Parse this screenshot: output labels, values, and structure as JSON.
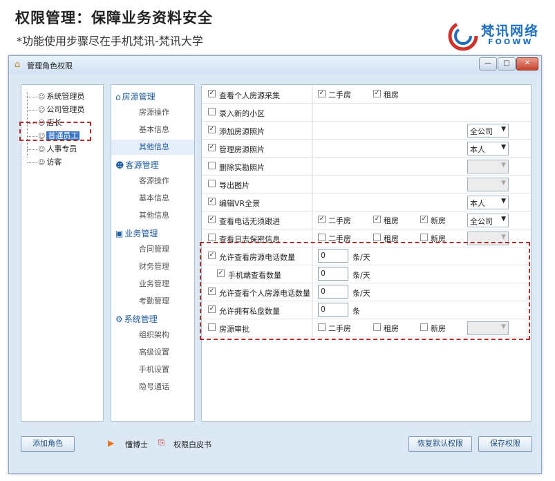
{
  "banner": {
    "title": "权限管理：保障业务资料安全",
    "subtitle": "*功能使用步骤尽在手机梵讯-梵讯大学",
    "logo_cn": "梵讯网络",
    "logo_en": "FOOWW"
  },
  "window": {
    "title": "管理角色权限",
    "controls": {
      "minimize": "—",
      "maximize": "□",
      "close": "✕"
    }
  },
  "roles": [
    "系统管理员",
    "公司管理员",
    "店长",
    "普通员工",
    "人事专员",
    "访客"
  ],
  "selected_role": "普通员工",
  "modules": [
    {
      "name": "房源管理",
      "icon": "house-icon",
      "items": [
        "房源操作",
        "基本信息",
        "其他信息"
      ]
    },
    {
      "name": "客源管理",
      "icon": "person-icon",
      "items": [
        "客源操作",
        "基本信息",
        "其他信息"
      ]
    },
    {
      "name": "业务管理",
      "icon": "briefcase-icon",
      "items": [
        "合同管理",
        "财务管理",
        "业务管理",
        "考勤管理"
      ]
    },
    {
      "name": "系统管理",
      "icon": "gear-icon",
      "items": [
        "组织架构",
        "高级设置",
        "手机设置",
        "隐号通话"
      ]
    }
  ],
  "selected_module_item": "其他信息",
  "permissions": [
    {
      "label": "查看个人房源采集",
      "checked": true,
      "options": [
        {
          "label": "二手房",
          "checked": true
        },
        {
          "label": "租房",
          "checked": true
        }
      ]
    },
    {
      "label": "录入新的小区",
      "checked": false
    },
    {
      "label": "添加房源照片",
      "checked": true,
      "select": {
        "value": "全公司",
        "disabled": false
      }
    },
    {
      "label": "管理房源照片",
      "checked": true,
      "select": {
        "value": "本人",
        "disabled": false
      }
    },
    {
      "label": "删除实勘照片",
      "checked": false,
      "select": {
        "value": "",
        "disabled": true
      }
    },
    {
      "label": "导出图片",
      "checked": false,
      "select": {
        "value": "",
        "disabled": true
      }
    },
    {
      "label": "编辑VR全景",
      "checked": true,
      "select": {
        "value": "本人",
        "disabled": false
      }
    },
    {
      "label": "查看电话无须跟进",
      "checked": true,
      "options": [
        {
          "label": "二手房",
          "checked": true
        },
        {
          "label": "租房",
          "checked": true
        },
        {
          "label": "新房",
          "checked": true
        }
      ],
      "select": {
        "value": "全公司",
        "disabled": false
      }
    },
    {
      "label": "查看日志保密信息",
      "checked": false,
      "options": [
        {
          "label": "二手房",
          "checked": false
        },
        {
          "label": "租房",
          "checked": false
        },
        {
          "label": "新房",
          "checked": false
        }
      ],
      "select": {
        "value": "",
        "disabled": true
      }
    },
    {
      "label": "允许查看房源电话数量",
      "checked": true,
      "number": "0",
      "unit": "条/天"
    },
    {
      "label": "手机端查看数量",
      "checked": true,
      "indent": true,
      "number": "0",
      "unit": "条/天"
    },
    {
      "label": "允许查看个人房源电话数量",
      "checked": true,
      "number": "0",
      "unit": "条/天"
    },
    {
      "label": "允许拥有私盘数量",
      "checked": true,
      "number": "0",
      "unit": "条"
    },
    {
      "label": "房源审批",
      "checked": false,
      "options": [
        {
          "label": "二手房",
          "checked": false
        },
        {
          "label": "租房",
          "checked": false
        },
        {
          "label": "新房",
          "checked": false
        }
      ],
      "select": {
        "value": "",
        "disabled": true
      }
    }
  ],
  "footer": {
    "add_role": "添加角色",
    "doctor": "懂博士",
    "whitepaper": "权限白皮书",
    "restore": "恢复默认权限",
    "save": "保存权限"
  },
  "colors": {
    "accent": "#1f5d9e",
    "selection": "#3b78c8",
    "highlight": "#b52a26"
  }
}
